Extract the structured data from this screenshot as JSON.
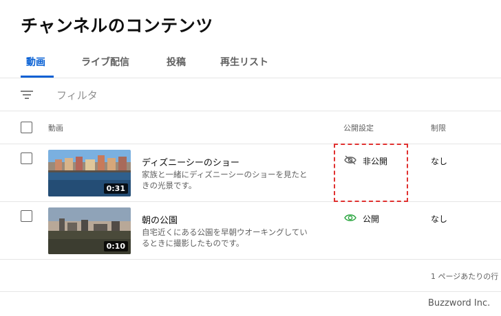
{
  "page": {
    "title": "チャンネルのコンテンツ"
  },
  "tabs": [
    {
      "label": "動画",
      "active": true
    },
    {
      "label": "ライブ配信",
      "active": false
    },
    {
      "label": "投稿",
      "active": false
    },
    {
      "label": "再生リスト",
      "active": false
    }
  ],
  "filter": {
    "icon": "filter-icon",
    "label": "フィルタ"
  },
  "table": {
    "headers": {
      "video": "動画",
      "visibility": "公開設定",
      "restriction": "制限"
    },
    "rows": [
      {
        "title": "ディズニーシーのショー",
        "description": "家族と一緒にディズニーシーのショーを見たときの光景です。",
        "duration": "0:31",
        "visibility": "非公開",
        "visibility_icon": "eye-off-icon",
        "restriction": "なし"
      },
      {
        "title": "朝の公園",
        "description": "自宅近くにある公園を早朝ウオーキングしているときに撮影したものです。",
        "duration": "0:10",
        "visibility": "公開",
        "visibility_icon": "eye-icon",
        "visibility_color": "#2ba640",
        "restriction": "なし"
      }
    ]
  },
  "pagination": {
    "label": "1 ページあたりの行"
  },
  "watermark": "Buzzword Inc.",
  "colors": {
    "accent": "#065fd4",
    "highlight": "#e0302f",
    "public_green": "#2ba640"
  }
}
